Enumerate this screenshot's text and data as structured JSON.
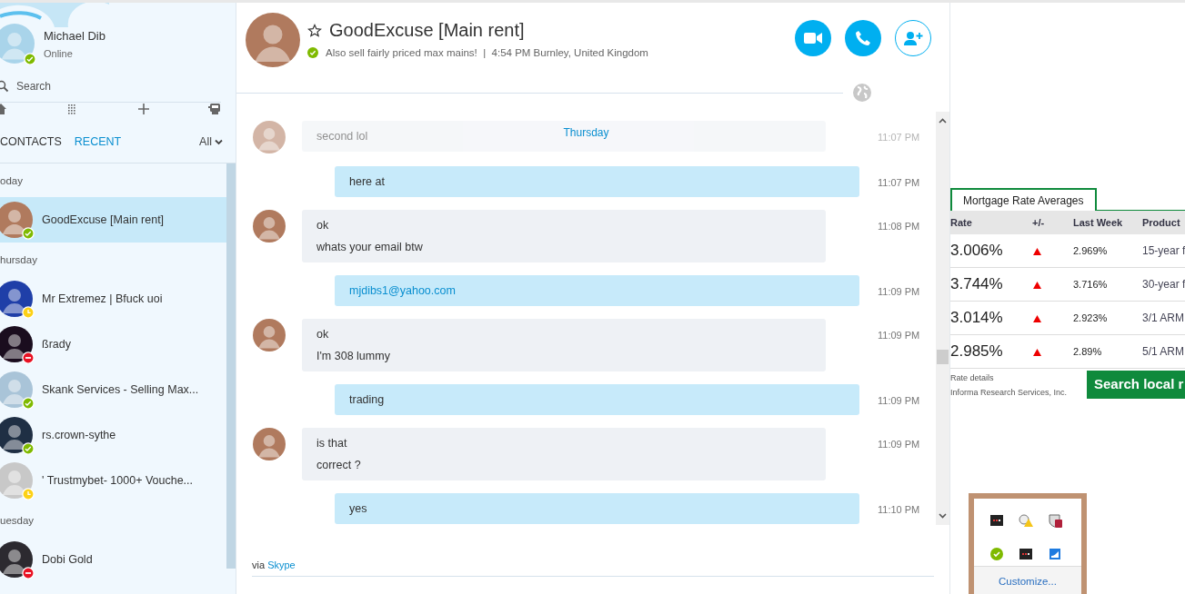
{
  "profile": {
    "name": "Michael Dib",
    "status_text": "Online",
    "color": "#7fba00"
  },
  "search": {
    "placeholder": "Search"
  },
  "sidebar_tabs": [
    {
      "label": "CONTACTS",
      "selected": false
    },
    {
      "label": "RECENT",
      "selected": true
    }
  ],
  "filter": {
    "label": "All"
  },
  "recent_groups": [
    {
      "label": "oday",
      "contacts": [
        {
          "name": "GoodExcuse [Main rent]",
          "color": "#7fba00",
          "selected": true
        }
      ]
    },
    {
      "label": "hursday",
      "contacts": [
        {
          "name": "Mr Extremez | Bfuck uoi",
          "color": "#fcd116",
          "selected": false
        },
        {
          "name": "ßrady",
          "color": "#e81123",
          "selected": false
        },
        {
          "name": "Skank Services - Selling Max...",
          "color": "#7fba00",
          "selected": false
        },
        {
          "name": "rs.crown-sythe",
          "color": "#7fba00",
          "selected": false
        },
        {
          "name": "' Trustmybet- 1000+ Vouche...",
          "color": "#fcd116",
          "selected": false
        }
      ]
    },
    {
      "label": "uesday",
      "contacts": [
        {
          "name": "Dobi Gold",
          "color": "#e81123",
          "selected": false
        }
      ]
    }
  ],
  "chat": {
    "title": "GoodExcuse [Main rent]",
    "color": "#7fba00",
    "mood": "Also sell fairly priced max mains!  |  4:54 PM Burnley, United Kingdom",
    "day_label": "Thursday",
    "messages": [
      {
        "kind": "incoming",
        "faded": true,
        "lines": [
          {
            "text": "second lol",
            "link": false
          }
        ],
        "time": "11:07 PM"
      },
      {
        "kind": "outgoing",
        "faded": false,
        "lines": [
          {
            "text": "here at",
            "link": false
          }
        ],
        "time": "11:07 PM"
      },
      {
        "kind": "incoming",
        "faded": false,
        "lines": [
          {
            "text": "ok",
            "link": false
          },
          {
            "text": "whats your email btw",
            "link": false
          }
        ],
        "time": "11:08 PM"
      },
      {
        "kind": "outgoing",
        "faded": false,
        "lines": [
          {
            "text": "mjdibs1@yahoo.com",
            "link": true
          }
        ],
        "time": "11:09 PM"
      },
      {
        "kind": "incoming",
        "faded": false,
        "lines": [
          {
            "text": "ok",
            "link": false
          },
          {
            "text": "I'm 308 lummy",
            "link": false
          }
        ],
        "time": "11:09 PM"
      },
      {
        "kind": "outgoing",
        "faded": false,
        "lines": [
          {
            "text": "trading",
            "link": false
          }
        ],
        "time": "11:09 PM"
      },
      {
        "kind": "incoming",
        "faded": false,
        "lines": [
          {
            "text": "is that",
            "link": false
          },
          {
            "text": "correct ?",
            "link": false
          }
        ],
        "time": "11:09 PM"
      },
      {
        "kind": "outgoing",
        "faded": false,
        "lines": [
          {
            "text": "yes",
            "link": false
          }
        ],
        "time": "11:10 PM"
      }
    ],
    "via": "via",
    "via_link": "Skype"
  },
  "mortgage": {
    "tab": "Mortgage Rate Averages",
    "columns": [
      "Rate",
      "+/-",
      "Last Week",
      "Product"
    ],
    "rows": [
      {
        "rate": "3.006%",
        "rising": true,
        "last_week": "2.969%",
        "product": "15-year f"
      },
      {
        "rate": "3.744%",
        "rising": true,
        "last_week": "3.716%",
        "product": "30-year f"
      },
      {
        "rate": "3.014%",
        "rising": true,
        "last_week": "2.923%",
        "product": "3/1 ARM"
      },
      {
        "rate": "2.985%",
        "rising": true,
        "last_week": "2.89%",
        "product": "5/1 ARM"
      }
    ],
    "details": "Rate details",
    "source": "Informa Research Services, Inc.",
    "button": "Search local r"
  },
  "tray": {
    "link": "Customize..."
  }
}
